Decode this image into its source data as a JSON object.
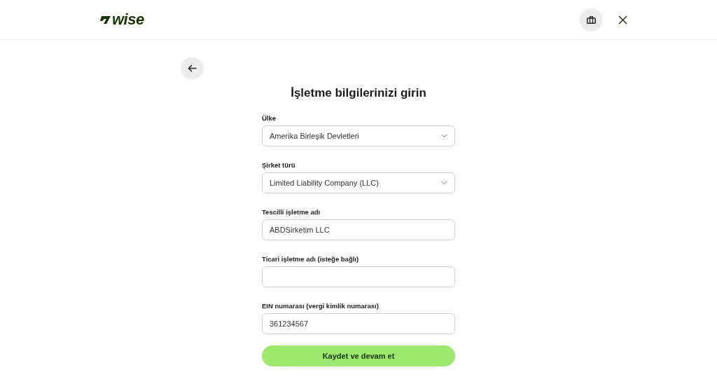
{
  "header": {
    "logo": "wise"
  },
  "title": "İşletme bilgilerinizi girin",
  "fields": [
    {
      "kind": "select",
      "label": "Ülke",
      "value": "Amerika Birleşik Devletleri"
    },
    {
      "kind": "select",
      "label": "Şirket türü",
      "value": "Limited Liability Company (LLC)"
    },
    {
      "kind": "text",
      "label": "Tescilli işletme adı",
      "value": "ABDSirketim LLC"
    },
    {
      "kind": "text",
      "label": "Ticari işletme adı (isteğe bağlı)"
    },
    {
      "kind": "text",
      "label": "EIN numarası (vergi kimlik numarası)",
      "value": "361234567"
    }
  ],
  "submit": "Kaydet ve devam et"
}
